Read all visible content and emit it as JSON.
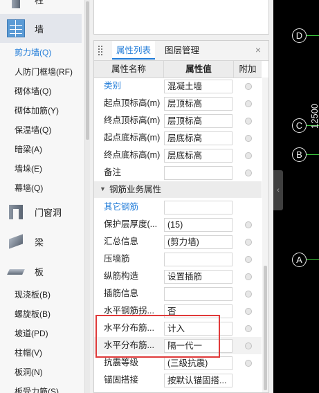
{
  "nav": {
    "categories": [
      {
        "label": "柱",
        "icon": "column-icon"
      },
      {
        "label": "墙",
        "icon": "wall-icon",
        "active": true
      },
      {
        "label": "门窗洞",
        "icon": "door-window-icon"
      },
      {
        "label": "梁",
        "icon": "beam-icon"
      },
      {
        "label": "板",
        "icon": "slab-icon"
      }
    ],
    "wall_items": [
      "剪力墙(Q)",
      "人防门框墙(RF)",
      "砌体墙(Q)",
      "砌体加筋(Y)",
      "保温墙(Q)",
      "暗梁(A)",
      "墙垛(E)",
      "幕墙(Q)"
    ],
    "slab_items": [
      "现浇板(B)",
      "螺旋板(B)",
      "坡道(PD)",
      "柱帽(V)",
      "板洞(N)",
      "板受力筋(S)"
    ]
  },
  "panel": {
    "tabs": [
      "属性列表",
      "图层管理"
    ],
    "close": "×",
    "headers": {
      "name": "属性名称",
      "value": "属性值",
      "add": "附加"
    },
    "rows_top": [
      {
        "name": "类别",
        "value": "混凝土墙",
        "blue": true,
        "check": true
      },
      {
        "name": "起点顶标高(m)",
        "value": "层顶标高",
        "check": true
      },
      {
        "name": "终点顶标高(m)",
        "value": "层顶标高",
        "check": true
      },
      {
        "name": "起点底标高(m)",
        "value": "层底标高",
        "check": true
      },
      {
        "name": "终点底标高(m)",
        "value": "层底标高",
        "check": true
      },
      {
        "name": "备注",
        "value": "",
        "check": true
      }
    ],
    "group_label": "钢筋业务属性",
    "rows_bottom": [
      {
        "name": "其它钢筋",
        "value": "",
        "blue": true,
        "check": false
      },
      {
        "name": "保护层厚度(...",
        "value": "(15)",
        "check": true
      },
      {
        "name": "汇总信息",
        "value": "(剪力墙)",
        "check": true
      },
      {
        "name": "压墙筋",
        "value": "",
        "check": true
      },
      {
        "name": "纵筋构造",
        "value": "设置插筋",
        "check": true
      },
      {
        "name": "插筋信息",
        "value": "",
        "check": true
      },
      {
        "name": "水平钢筋拐...",
        "value": "否",
        "check": true
      },
      {
        "name": "水平分布筋...",
        "value": "计入",
        "check": true
      },
      {
        "name": "水平分布筋...",
        "value": "隔一代一",
        "check": true,
        "highlight": true
      },
      {
        "name": "抗震等级",
        "value": "(三级抗震)",
        "check": true
      },
      {
        "name": "锚固搭接",
        "value": "按默认锚固搭...",
        "check": false
      }
    ]
  },
  "canvas": {
    "axes": [
      "D",
      "C",
      "B",
      "A"
    ],
    "dimension": "12500",
    "collapse": "‹"
  }
}
